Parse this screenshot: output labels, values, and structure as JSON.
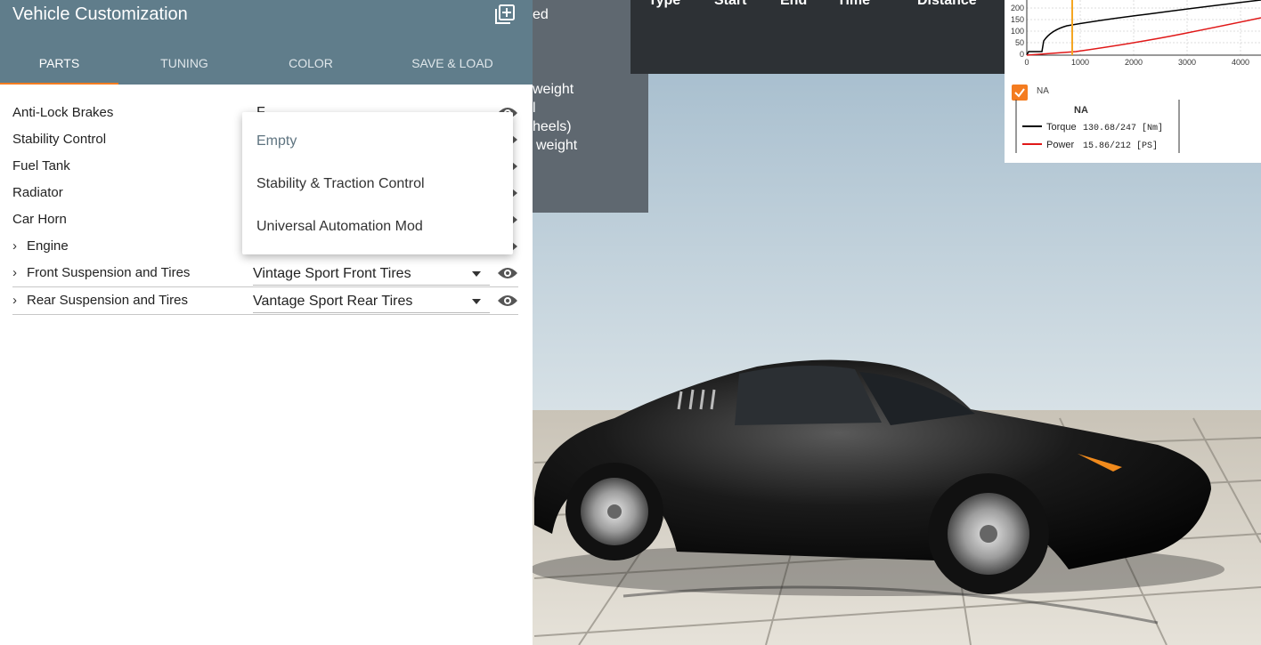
{
  "panel": {
    "title": "Vehicle Customization",
    "tabs": [
      {
        "label": "PARTS",
        "active": true
      },
      {
        "label": "TUNING"
      },
      {
        "label": "COLOR"
      },
      {
        "label": "SAVE & LOAD"
      }
    ],
    "accent_color": "#f47c20",
    "header_color": "#607d8b"
  },
  "parts": [
    {
      "label": "Anti-Lock Brakes",
      "value_partial": "F..."
    },
    {
      "label": "Stability Control"
    },
    {
      "label": "Fuel Tank"
    },
    {
      "label": "Radiator"
    },
    {
      "label": "Car Horn"
    },
    {
      "label": "Engine"
    },
    {
      "label": "Front Suspension and Tires",
      "value": "Vintage Sport Front Tires"
    },
    {
      "label": "Rear Suspension and Tires",
      "value": "Vantage Sport Rear Tires"
    }
  ],
  "dropdown": {
    "options": [
      "Empty",
      "Stability & Traction Control",
      "Universal Automation Mod"
    ]
  },
  "overlay": {
    "headers": [
      "Type",
      "Start",
      "End",
      "Time",
      "Distance"
    ],
    "partial_lines": [
      "ed",
      "weight",
      "l",
      "heels)",
      "weight"
    ]
  },
  "graph": {
    "checkbox_label": "NA",
    "legend_title": "NA",
    "torque_label": "Torque",
    "torque_value": "130.68/247 [Nm]",
    "power_label": "Power",
    "power_value": "15.86/212  [PS]",
    "y_ticks": [
      "200",
      "150",
      "100",
      "50",
      "0"
    ],
    "x_ticks": [
      "0",
      "1000",
      "2000",
      "3000",
      "4000"
    ],
    "torque_color": "#000000",
    "power_color": "#e01818",
    "cursor_color": "#f5a623"
  }
}
